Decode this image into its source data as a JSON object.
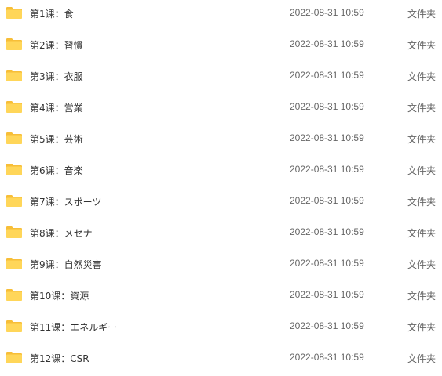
{
  "icon": "folder-icon",
  "colors": {
    "folder_body": "#FFD659",
    "folder_tab": "#F7BE38",
    "name_text": "#333333",
    "meta_text": "#666666"
  },
  "files": [
    {
      "name": "第1课：食",
      "modified": "2022-08-31 10:59",
      "type": "文件夹"
    },
    {
      "name": "第2课：習慣",
      "modified": "2022-08-31 10:59",
      "type": "文件夹"
    },
    {
      "name": "第3课：衣服",
      "modified": "2022-08-31 10:59",
      "type": "文件夹"
    },
    {
      "name": "第4课：営業",
      "modified": "2022-08-31 10:59",
      "type": "文件夹"
    },
    {
      "name": "第5课：芸術",
      "modified": "2022-08-31 10:59",
      "type": "文件夹"
    },
    {
      "name": "第6课：音楽",
      "modified": "2022-08-31 10:59",
      "type": "文件夹"
    },
    {
      "name": "第7课：スポーツ",
      "modified": "2022-08-31 10:59",
      "type": "文件夹"
    },
    {
      "name": "第8课：メセナ",
      "modified": "2022-08-31 10:59",
      "type": "文件夹"
    },
    {
      "name": "第9课：自然災害",
      "modified": "2022-08-31 10:59",
      "type": "文件夹"
    },
    {
      "name": "第10课：資源",
      "modified": "2022-08-31 10:59",
      "type": "文件夹"
    },
    {
      "name": "第11课：エネルギー",
      "modified": "2022-08-31 10:59",
      "type": "文件夹"
    },
    {
      "name": "第12课：CSR",
      "modified": "2022-08-31 10:59",
      "type": "文件夹"
    }
  ]
}
